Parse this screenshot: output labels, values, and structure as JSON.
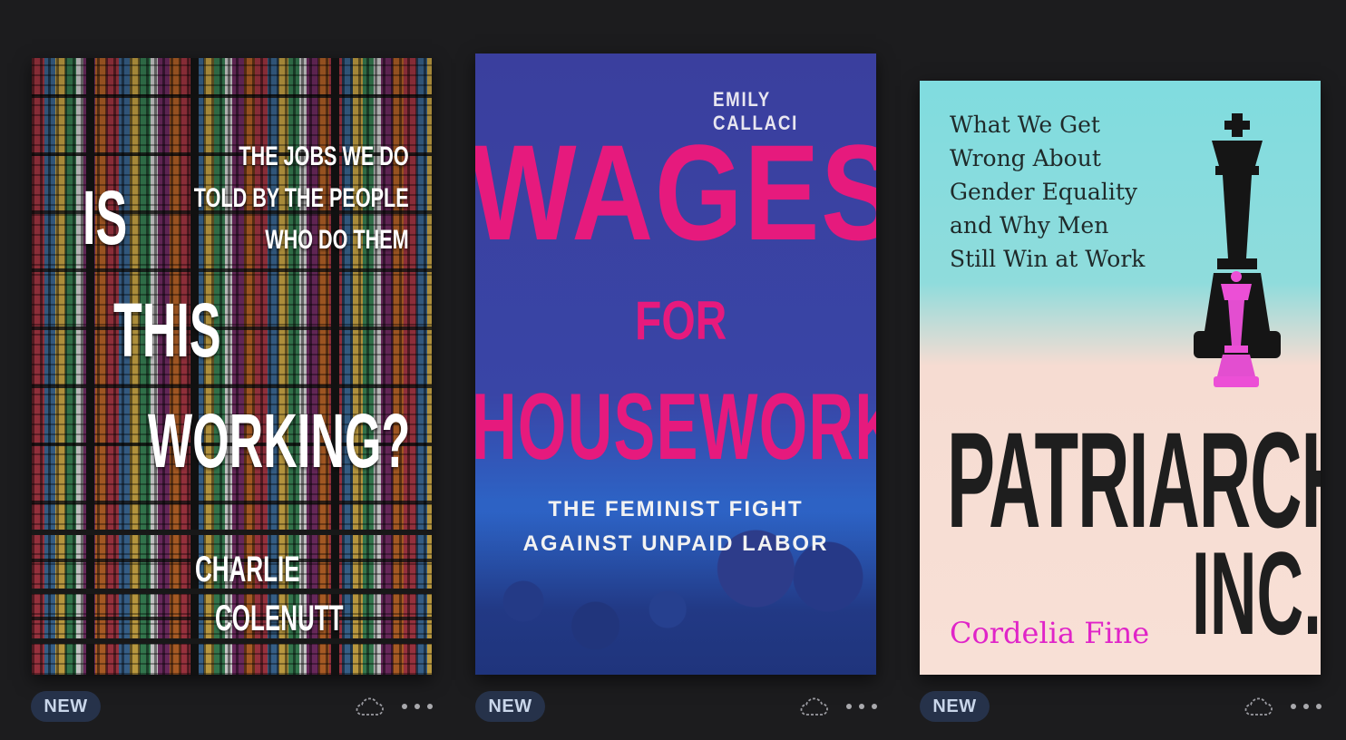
{
  "books": [
    {
      "cover": {
        "subtitle_lines": [
          "THE JOBS WE DO",
          "TOLD BY THE PEOPLE",
          "WHO DO THEM"
        ],
        "title_lines": [
          "IS",
          "THIS",
          "WORKING?"
        ],
        "author_lines": [
          "CHARLIE",
          "COLENUTT"
        ]
      },
      "badge": "NEW",
      "icons": {
        "cloud": "cloud-download-icon",
        "more": "more-options-icon"
      }
    },
    {
      "cover": {
        "author": "EMILY CALLACI",
        "title_lines": [
          "WAGES",
          "FOR",
          "HOUSEWORK"
        ],
        "subtitle_lines": [
          "THE FEMINIST FIGHT",
          "AGAINST UNPAID LABOR"
        ]
      },
      "badge": "NEW",
      "icons": {
        "cloud": "cloud-download-icon",
        "more": "more-options-icon"
      }
    },
    {
      "cover": {
        "subtitle_lines": [
          "What We Get",
          "Wrong About",
          "Gender Equality",
          "and Why Men",
          "Still Win at Work"
        ],
        "title_lines": [
          "PATRIARCHY",
          "INC."
        ],
        "author": "Cordelia Fine"
      },
      "badge": "NEW",
      "icons": {
        "cloud": "cloud-download-icon",
        "more": "more-options-icon"
      }
    }
  ],
  "colors": {
    "background": "#1c1c1e",
    "badge_bg": "#26324a",
    "badge_text": "#c9d6ea",
    "wages_pink": "#e61a7d",
    "cordelia_magenta": "#e024c8"
  }
}
